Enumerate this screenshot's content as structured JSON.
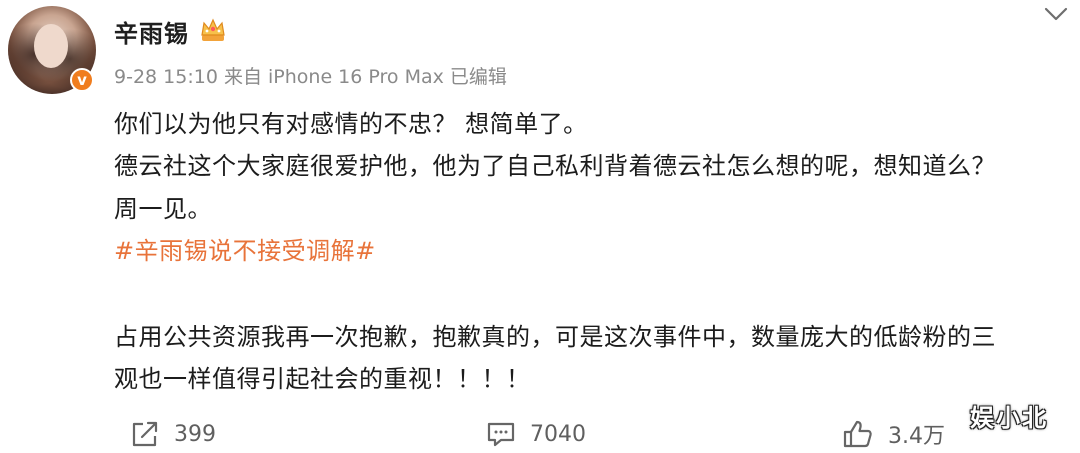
{
  "post": {
    "username": "辛雨锡",
    "meta": "9-28 15:10 来自 iPhone 16 Pro Max 已编辑",
    "lines": [
      "你们以为他只有对感情的不忠？ 想简单了。",
      "德云社这个大家庭很爱护他，他为了自己私利背着德云社怎么想的呢，想知道么？",
      "周一见。",
      "#辛雨锡说不接受调解#",
      "占用公共资源我再一次抱歉，抱歉真的，可是这次事件中，数量庞大的低龄粉的三",
      "观也一样值得引起社会的重视！！！！"
    ]
  },
  "actions": {
    "repost_count": "399",
    "comment_count": "7040",
    "like_count": "3.4万"
  },
  "watermark": "娱小北",
  "colors": {
    "hashtag": "#e8733a",
    "verified_badge": "#f07d1e",
    "meta_text": "#8a8a8a"
  },
  "icons": [
    "chevron-down-icon",
    "crown-icon",
    "verified-badge-icon",
    "repost-icon",
    "comment-icon",
    "like-icon"
  ]
}
